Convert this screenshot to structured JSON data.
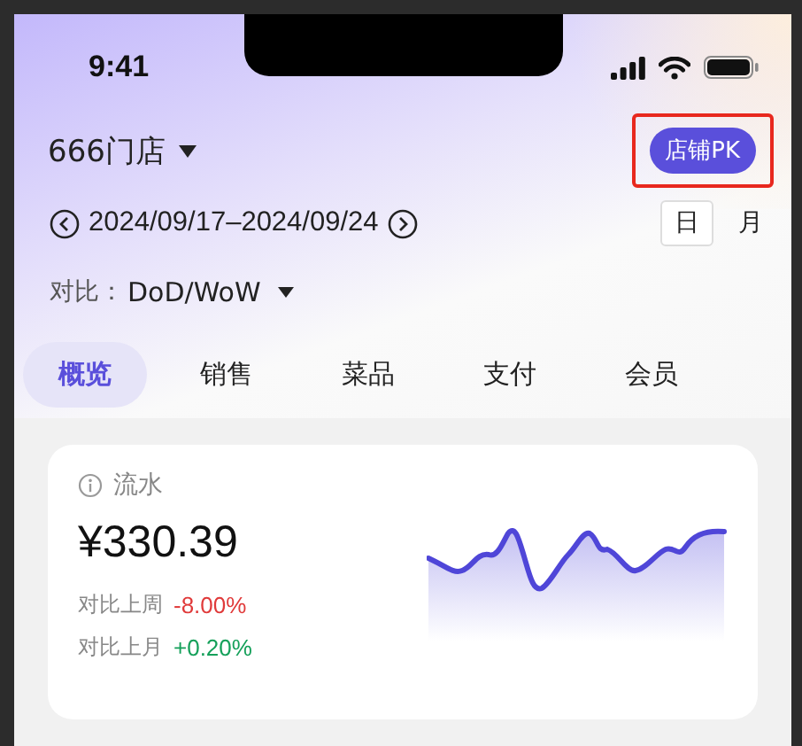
{
  "status_bar": {
    "time": "9:41"
  },
  "store": {
    "name": "666门店",
    "action": "店铺PK",
    "action_highlighted": true
  },
  "date_range": {
    "text": "2024/09/17–2024/09/24",
    "periods": [
      {
        "label": "日",
        "selected": true
      },
      {
        "label": "月",
        "selected": false
      }
    ]
  },
  "compare": {
    "label": "对比：",
    "value": "DoD/WoW"
  },
  "tabs": [
    {
      "label": "概览",
      "selected": true
    },
    {
      "label": "销售",
      "selected": false
    },
    {
      "label": "菜品",
      "selected": false
    },
    {
      "label": "支付",
      "selected": false
    },
    {
      "label": "会员",
      "selected": false
    }
  ],
  "metric_card": {
    "title": "流水",
    "value": "¥330.39",
    "comparisons": [
      {
        "label": "对比上周",
        "change": "-8.00%",
        "color": "#e03a3a"
      },
      {
        "label": "对比上月",
        "change": "+0.20%",
        "color": "#15a05a"
      }
    ]
  }
}
